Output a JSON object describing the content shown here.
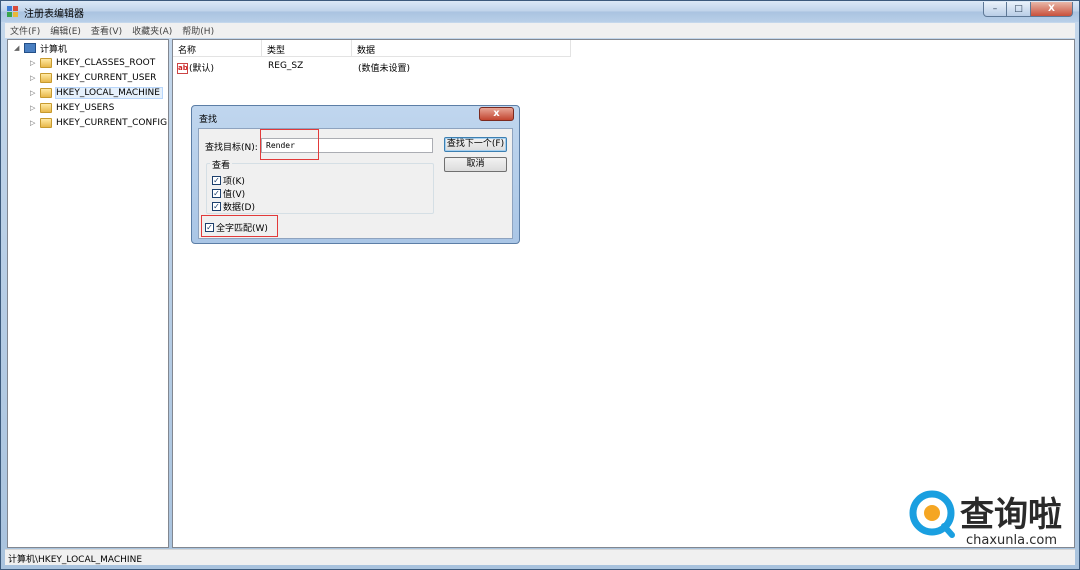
{
  "window": {
    "title": "注册表编辑器",
    "min_label": "–",
    "max_label": "□",
    "close_label": "X"
  },
  "menu": [
    "文件(F)",
    "编辑(E)",
    "查看(V)",
    "收藏夹(A)",
    "帮助(H)"
  ],
  "tree": {
    "root": "计算机",
    "items": [
      "HKEY_CLASSES_ROOT",
      "HKEY_CURRENT_USER",
      "HKEY_LOCAL_MACHINE",
      "HKEY_USERS",
      "HKEY_CURRENT_CONFIG"
    ],
    "selected": "HKEY_LOCAL_MACHINE"
  },
  "list": {
    "headers": {
      "name": "名称",
      "type": "类型",
      "data": "数据"
    },
    "rows": [
      {
        "name": "(默认)",
        "type": "REG_SZ",
        "data": "(数值未设置)",
        "icon": "ab"
      }
    ]
  },
  "dialog": {
    "title": "查找",
    "close_label": "x",
    "find_label": "查找目标(N):",
    "find_value": "Render",
    "find_next": "查找下一个(F)",
    "cancel": "取消",
    "look_at": "查看",
    "options": [
      {
        "label": "项(K)",
        "checked": true
      },
      {
        "label": "值(V)",
        "checked": true
      },
      {
        "label": "数据(D)",
        "checked": true
      }
    ],
    "match_whole": {
      "label": "全字匹配(W)",
      "checked": true
    }
  },
  "status": "计算机\\HKEY_LOCAL_MACHINE",
  "watermark": {
    "brand": "查询啦",
    "url": "chaxunla.com",
    "color": "#1a9fe0"
  }
}
